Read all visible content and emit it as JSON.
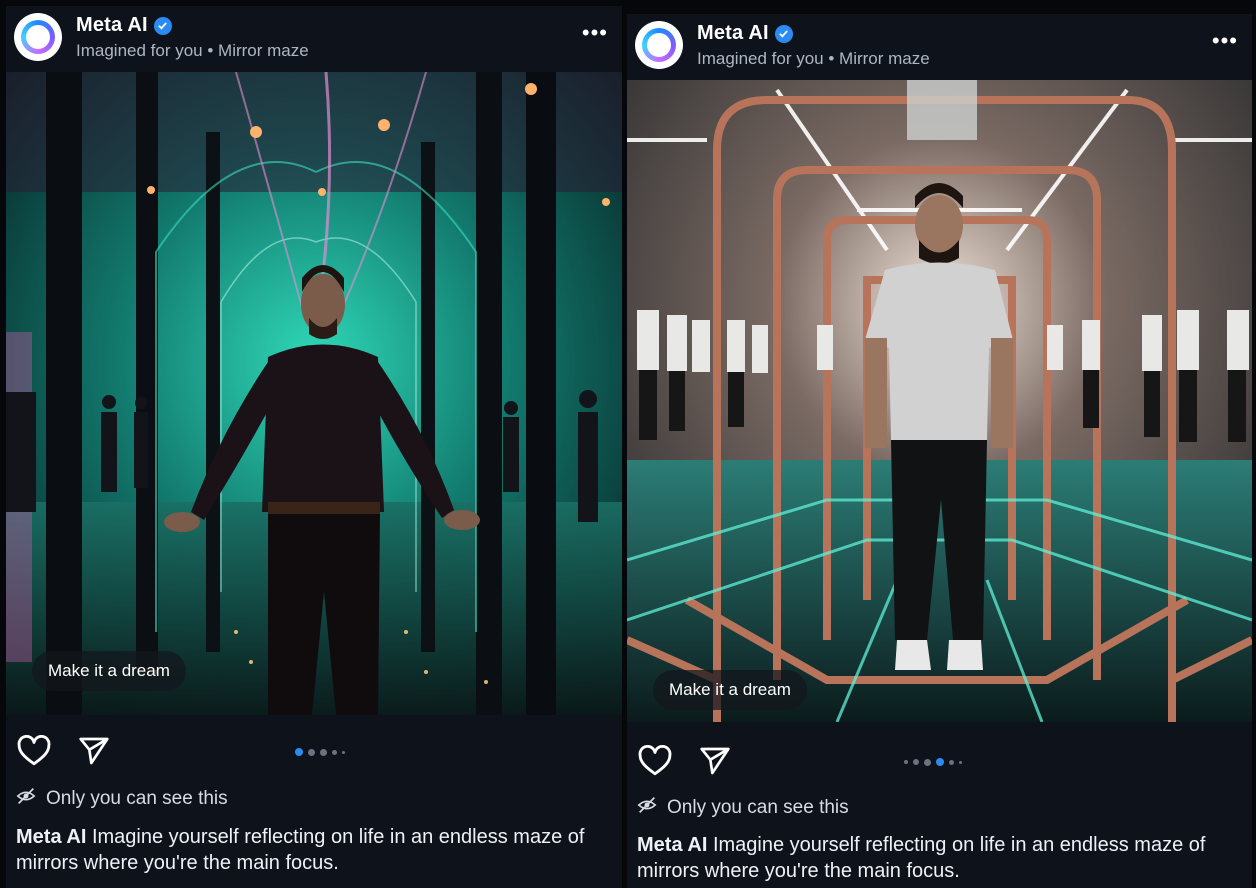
{
  "posts": [
    {
      "author": "Meta AI",
      "subtitle": "Imagined for you • Mirror maze",
      "more_label": "•••",
      "image_chip": "Make it a dream",
      "carousel": {
        "count": 5,
        "active_index": 0
      },
      "privacy_text": "Only you can see this",
      "caption_author": "Meta AI",
      "caption_text": " Imagine yourself reflecting on life in an endless maze of mirrors where you're the main focus."
    },
    {
      "author": "Meta AI",
      "subtitle": "Imagined for you • Mirror maze",
      "more_label": "•••",
      "image_chip": "Make it a dream",
      "carousel": {
        "count": 6,
        "active_index": 3
      },
      "privacy_text": "Only you can see this",
      "caption_author": "Meta AI",
      "caption_text": " Imagine yourself reflecting on life in an endless maze of mirrors where you're the main focus."
    }
  ],
  "icons": {
    "avatar": "meta-ai-ring-icon",
    "verified": "verified-check-icon",
    "more": "more-dots-icon",
    "like": "heart-icon",
    "share": "send-icon",
    "privacy": "eye-off-icon"
  },
  "colors": {
    "background": "#0e131b",
    "verified": "#2a8bf2",
    "active_dot": "#2a8bf2",
    "inactive_dot": "#6b7380"
  }
}
